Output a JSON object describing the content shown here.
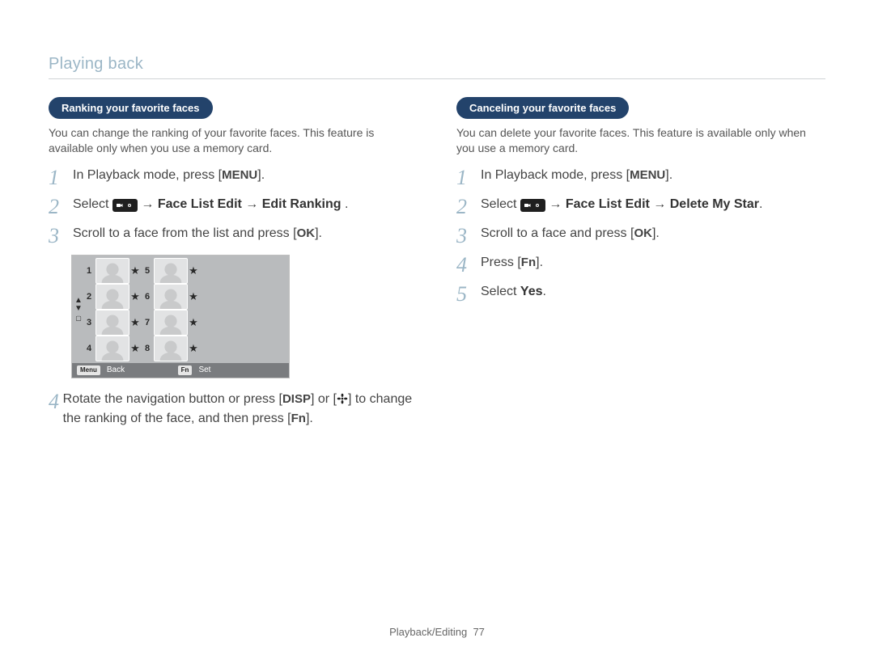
{
  "section": "Playing back",
  "footer": {
    "section": "Playback/Editing",
    "page": "77"
  },
  "left": {
    "pill": "Ranking your favorite faces",
    "intro": "You can change the ranking of your favorite faces. This feature is available only when you use a memory card.",
    "steps": {
      "1": {
        "num": "1",
        "pre": "In Playback mode, press [",
        "key": "MENU",
        "post": "]."
      },
      "2": {
        "num": "2",
        "pre": "Select ",
        "arrow": " → ",
        "b1": "Face List Edit",
        "b2": "Edit Ranking",
        "post": " ."
      },
      "3": {
        "num": "3",
        "pre": "Scroll to a face from the list and press [",
        "key": "OK",
        "post": "]."
      },
      "4": {
        "num": "4",
        "pre": "Rotate the navigation button or press [",
        "key1": "DISP",
        "mid": "] or [",
        "key2_alt": "macro",
        "mid2": "] to change the ranking of the face, and then press [",
        "key3": "Fn",
        "post": "]."
      }
    }
  },
  "right": {
    "pill": "Canceling your favorite faces",
    "intro": "You can delete your favorite faces. This feature is available only when you use a memory card.",
    "steps": {
      "1": {
        "num": "1",
        "pre": "In Playback mode, press [",
        "key": "MENU",
        "post": "]."
      },
      "2": {
        "num": "2",
        "pre": "Select ",
        "arrow": " → ",
        "b1": "Face List Edit",
        "b2": "Delete My Star",
        "post": "."
      },
      "3": {
        "num": "3",
        "pre": "Scroll to a face and press [",
        "key": "OK",
        "post": "]."
      },
      "4": {
        "num": "4",
        "pre": "Press [",
        "key": "Fn",
        "post": "]."
      },
      "5": {
        "num": "5",
        "pre": "Select ",
        "b": "Yes",
        "post": "."
      }
    }
  },
  "figure": {
    "left_ranks": [
      "1",
      "2",
      "3",
      "4"
    ],
    "right_ranks": [
      "5",
      "6",
      "7",
      "8"
    ],
    "star": "★",
    "back_key": "Menu",
    "back_label": "Back",
    "set_key": "Fn",
    "set_label": "Set"
  }
}
